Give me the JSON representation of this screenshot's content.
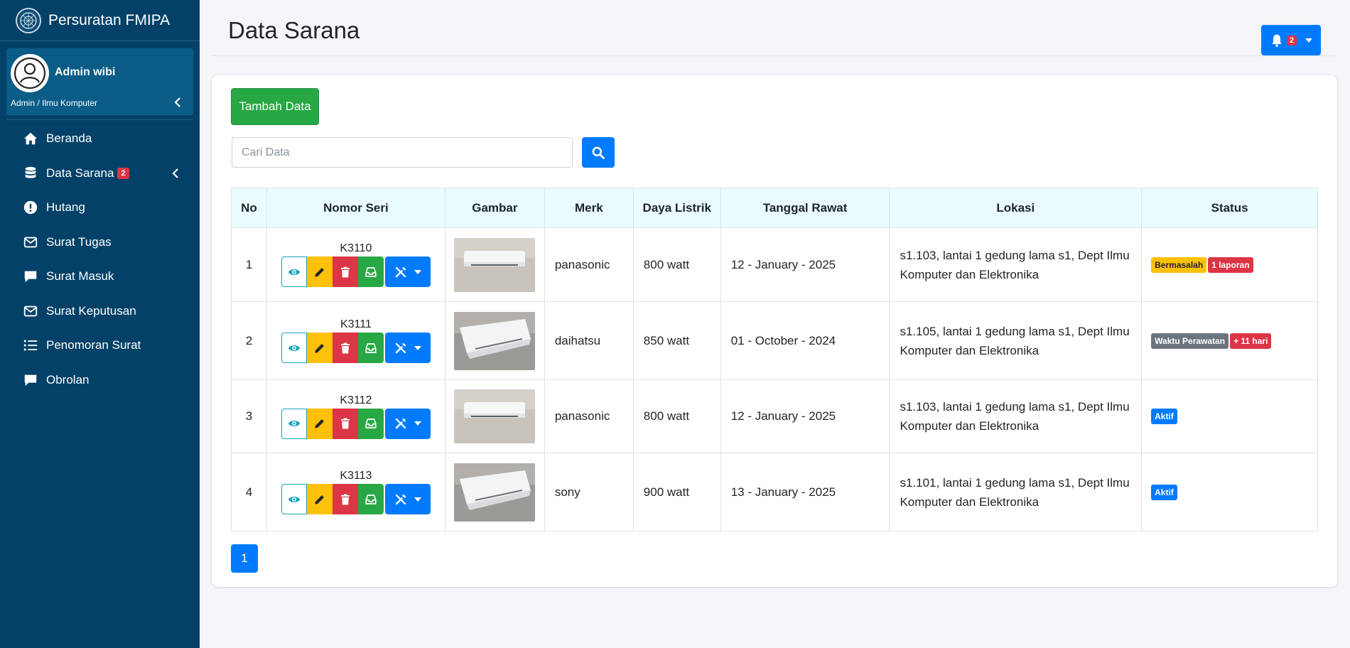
{
  "app": {
    "title": "Persuratan FMIPA"
  },
  "user": {
    "name": "Admin wibi",
    "role": "Admin / Ilmu Komputer"
  },
  "sidebar": {
    "items": [
      {
        "label": "Beranda",
        "icon": "home-icon"
      },
      {
        "label": "Data Sarana",
        "icon": "database-icon",
        "badge": "2"
      },
      {
        "label": "Hutang",
        "icon": "exclamation-circle-icon"
      },
      {
        "label": "Surat Tugas",
        "icon": "envelope-icon"
      },
      {
        "label": "Surat Masuk",
        "icon": "comment-icon"
      },
      {
        "label": "Surat Keputusan",
        "icon": "envelope-icon"
      },
      {
        "label": "Penomoran Surat",
        "icon": "list-ol-icon"
      },
      {
        "label": "Obrolan",
        "icon": "comment-icon"
      }
    ]
  },
  "header": {
    "title": "Data Sarana",
    "notification_count": "2"
  },
  "toolbar": {
    "add_label": "Tambah Data"
  },
  "search": {
    "placeholder": "Cari Data"
  },
  "table": {
    "columns": [
      "No",
      "Nomor Seri",
      "Gambar",
      "Merk",
      "Daya Listrik",
      "Tanggal Rawat",
      "Lokasi",
      "Status"
    ],
    "rows": [
      {
        "no": "1",
        "serial": "K3110",
        "image": "ac-front",
        "brand": "panasonic",
        "power": "800 watt",
        "date": "12 - January - 2025",
        "location": "s1.103, lantai 1 gedung lama s1, Dept Ilmu Komputer dan Elektronika",
        "badges": [
          {
            "text": "Bermasalah",
            "variant": "warning"
          },
          {
            "text": "1 laporan",
            "variant": "danger"
          }
        ]
      },
      {
        "no": "2",
        "serial": "K3111",
        "image": "ac-angle",
        "brand": "daihatsu",
        "power": "850 watt",
        "date": "01 - October - 2024",
        "location": "s1.105, lantai 1 gedung lama s1, Dept Ilmu Komputer dan Elektronika",
        "badges": [
          {
            "text": "Waktu Perawatan",
            "variant": "secondary"
          },
          {
            "text": "+ 11 hari",
            "variant": "danger"
          }
        ]
      },
      {
        "no": "3",
        "serial": "K3112",
        "image": "ac-front",
        "brand": "panasonic",
        "power": "800 watt",
        "date": "12 - January - 2025",
        "location": "s1.103, lantai 1 gedung lama s1, Dept Ilmu Komputer dan Elektronika",
        "badges": [
          {
            "text": "Aktif",
            "variant": "primary"
          }
        ]
      },
      {
        "no": "4",
        "serial": "K3113",
        "image": "ac-angle",
        "brand": "sony",
        "power": "900 watt",
        "date": "13 - January - 2025",
        "location": "s1.101, lantai 1 gedung lama s1, Dept Ilmu Komputer dan Elektronika",
        "badges": [
          {
            "text": "Aktif",
            "variant": "primary"
          }
        ]
      }
    ]
  },
  "pagination": {
    "current": "1"
  },
  "colors": {
    "sidebar_bg": "#044168",
    "primary": "#007bff",
    "success": "#28a745",
    "warning": "#ffc107",
    "danger": "#dc3545",
    "secondary": "#6c757d",
    "table_header_bg": "#e9fbfd"
  }
}
